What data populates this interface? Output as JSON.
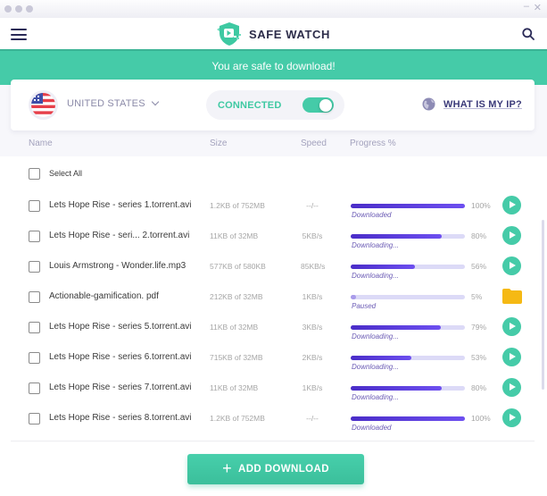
{
  "app": {
    "title": "SAFE WATCH",
    "window_controls": {
      "minimize": "–",
      "close": "✕"
    }
  },
  "header": {
    "menu_icon": "hamburger-menu-icon",
    "logo_icon": "shield-play-icon",
    "search_icon": "search-icon"
  },
  "banner": {
    "text": "You are safe to download!"
  },
  "controls": {
    "country": {
      "label": "UNITED STATES",
      "flag_icon": "us-flag-icon"
    },
    "connection": {
      "label": "CONNECTED",
      "toggle_on": true
    },
    "ip_link": {
      "label": "WHAT IS MY IP?",
      "icon": "globe-icon"
    }
  },
  "columns": {
    "name": "Name",
    "size": "Size",
    "speed": "Speed",
    "progress": "Progress %"
  },
  "select_all": {
    "label": "Select All",
    "checked": false
  },
  "downloads": [
    {
      "name": "Lets Hope Rise - series 1.torrent.avi",
      "size": "1.2KB of 752MB",
      "speed": "--/--",
      "progress": 100,
      "progress_label": "100%",
      "status": "Downloaded",
      "action": "play"
    },
    {
      "name": "Lets Hope Rise - seri... 2.torrent.avi",
      "size": "11KB of 32MB",
      "speed": "5KB/s",
      "progress": 80,
      "progress_label": "80%",
      "status": "Downloading...",
      "action": "play"
    },
    {
      "name": "Louis Armstrong - Wonder.life.mp3",
      "size": "577KB of 580KB",
      "speed": "85KB/s",
      "progress": 56,
      "progress_label": "56%",
      "status": "Downloading...",
      "action": "play"
    },
    {
      "name": "Actionable-gamification. pdf",
      "size": "212KB of 32MB",
      "speed": "1KB/s",
      "progress": 5,
      "progress_label": "5%",
      "status": "Paused",
      "action": "folder"
    },
    {
      "name": "Lets Hope Rise - series 5.torrent.avi",
      "size": "11KB of 32MB",
      "speed": "3KB/s",
      "progress": 79,
      "progress_label": "79%",
      "status": "Downloading...",
      "action": "play"
    },
    {
      "name": "Lets Hope Rise - series 6.torrent.avi",
      "size": "715KB of 32MB",
      "speed": "2KB/s",
      "progress": 53,
      "progress_label": "53%",
      "status": "Downloading...",
      "action": "play"
    },
    {
      "name": "Lets Hope Rise - series 7.torrent.avi",
      "size": "11KB of 32MB",
      "speed": "1KB/s",
      "progress": 80,
      "progress_label": "80%",
      "status": "Downloading...",
      "action": "play"
    },
    {
      "name": "Lets Hope Rise - series 8.torrent.avi",
      "size": "1.2KB of 752MB",
      "speed": "--/--",
      "progress": 100,
      "progress_label": "100%",
      "status": "Downloaded",
      "action": "play"
    }
  ],
  "footer": {
    "add_button_label": "ADD DOWNLOAD",
    "add_icon": "plus-icon"
  },
  "colors": {
    "accent": "#45cba8",
    "progress": "#4a2dc8",
    "progress_track": "#dcdaf7",
    "folder": "#f5b914",
    "text_dark": "#2d2d4a"
  }
}
